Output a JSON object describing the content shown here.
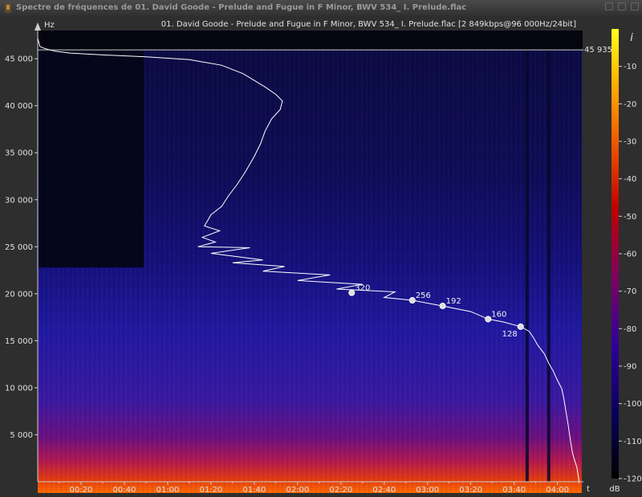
{
  "window": {
    "title": "Spectre de fréquences de 01. David Goode - Prelude and Fugue in F Minor, BWV 534_ I. Prelude.flac",
    "app_icon": "spek-icon"
  },
  "chart_data": {
    "type": "heatmap",
    "title": "01. David Goode - Prelude and Fugue in F Minor, BWV 534_ I. Prelude.flac [2 849kbps@96 000Hz/24bit]",
    "ylabel": "Hz",
    "xlabel": "t",
    "colorbar_label": "dB",
    "info_icon": "info-icon",
    "ylim": [
      0,
      48000
    ],
    "xlim": [
      0,
      252
    ],
    "yticks": [
      {
        "value": 5000,
        "label": "5 000"
      },
      {
        "value": 10000,
        "label": "10 000"
      },
      {
        "value": 15000,
        "label": "15 000"
      },
      {
        "value": 20000,
        "label": "20 000"
      },
      {
        "value": 25000,
        "label": "25 000"
      },
      {
        "value": 30000,
        "label": "30 000"
      },
      {
        "value": 35000,
        "label": "35 000"
      },
      {
        "value": 40000,
        "label": "40 000"
      },
      {
        "value": 45000,
        "label": "45 000"
      }
    ],
    "xticks": [
      {
        "value": 20,
        "label": "00:20"
      },
      {
        "value": 40,
        "label": "00:40"
      },
      {
        "value": 60,
        "label": "01:00"
      },
      {
        "value": 80,
        "label": "01:20"
      },
      {
        "value": 100,
        "label": "01:40"
      },
      {
        "value": 120,
        "label": "02:00"
      },
      {
        "value": 140,
        "label": "02:20"
      },
      {
        "value": 160,
        "label": "02:40"
      },
      {
        "value": 180,
        "label": "03:00"
      },
      {
        "value": 200,
        "label": "03:20"
      },
      {
        "value": 220,
        "label": "03:40"
      },
      {
        "value": 240,
        "label": "04:00"
      }
    ],
    "db_range": [
      -120,
      0
    ],
    "dbticks": [
      {
        "value": -10,
        "label": "-10"
      },
      {
        "value": -20,
        "label": "-20"
      },
      {
        "value": -30,
        "label": "-30"
      },
      {
        "value": -40,
        "label": "-40"
      },
      {
        "value": -50,
        "label": "-50"
      },
      {
        "value": -60,
        "label": "-60"
      },
      {
        "value": -70,
        "label": "-70"
      },
      {
        "value": -80,
        "label": "-80"
      },
      {
        "value": -90,
        "label": "-90"
      },
      {
        "value": -100,
        "label": "-100"
      },
      {
        "value": -110,
        "label": "-110"
      },
      {
        "value": -120,
        "label": "-120"
      }
    ],
    "cutoff_line": {
      "value": 45935,
      "label": "45 935"
    },
    "early_region": {
      "x_end": 49,
      "y_top": 22800
    },
    "bitrate_markers": [
      {
        "t": 145,
        "hz": 20100,
        "label": "320"
      },
      {
        "t": 173,
        "hz": 19300,
        "label": "256"
      },
      {
        "t": 187,
        "hz": 18700,
        "label": "192"
      },
      {
        "t": 208,
        "hz": 17300,
        "label": "160"
      },
      {
        "t": 223,
        "hz": 16500,
        "label": "128"
      }
    ],
    "profile_curve": [
      [
        0,
        48000
      ],
      [
        0,
        47200
      ],
      [
        1,
        46300
      ],
      [
        3,
        46100
      ],
      [
        8,
        45800
      ],
      [
        15,
        45600
      ],
      [
        30,
        45400
      ],
      [
        50,
        45200
      ],
      [
        70,
        44900
      ],
      [
        85,
        44300
      ],
      [
        95,
        43400
      ],
      [
        105,
        42000
      ],
      [
        110,
        41200
      ],
      [
        113,
        40500
      ],
      [
        112,
        39600
      ],
      [
        108,
        38600
      ],
      [
        105,
        37300
      ],
      [
        103,
        36000
      ],
      [
        100,
        34600
      ],
      [
        96,
        33000
      ],
      [
        92,
        31600
      ],
      [
        88,
        30400
      ],
      [
        85,
        29300
      ],
      [
        80,
        28400
      ],
      [
        77,
        27200
      ],
      [
        84,
        26700
      ],
      [
        76,
        26000
      ],
      [
        82,
        25500
      ],
      [
        74,
        25000
      ],
      [
        98,
        24900
      ],
      [
        80,
        24300
      ],
      [
        104,
        23600
      ],
      [
        90,
        23300
      ],
      [
        114,
        22900
      ],
      [
        104,
        22400
      ],
      [
        135,
        22000
      ],
      [
        120,
        21400
      ],
      [
        150,
        21000
      ],
      [
        138,
        20500
      ],
      [
        165,
        20200
      ],
      [
        160,
        19600
      ],
      [
        173,
        19300
      ],
      [
        187,
        18700
      ],
      [
        200,
        18100
      ],
      [
        208,
        17300
      ],
      [
        215,
        17000
      ],
      [
        223,
        16500
      ],
      [
        227,
        16000
      ],
      [
        229,
        15300
      ],
      [
        231,
        14500
      ],
      [
        234,
        13600
      ],
      [
        236,
        12600
      ],
      [
        238,
        11800
      ],
      [
        240,
        10800
      ],
      [
        242,
        9900
      ],
      [
        243,
        8800
      ],
      [
        244,
        7400
      ],
      [
        245,
        6000
      ],
      [
        246,
        4400
      ],
      [
        247,
        3000
      ],
      [
        249,
        1500
      ],
      [
        250,
        0
      ]
    ],
    "silence_columns": [
      226,
      236
    ]
  }
}
